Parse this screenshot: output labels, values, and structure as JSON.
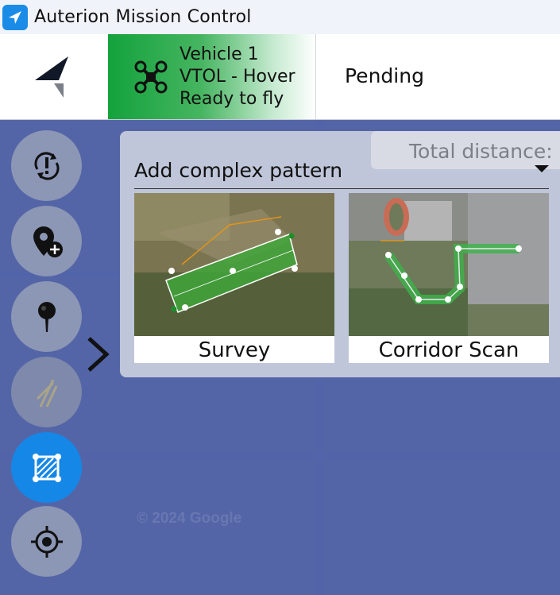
{
  "window": {
    "title": "Auterion Mission Control"
  },
  "header": {
    "vehicle": {
      "name": "Vehicle 1",
      "mode": "VTOL - Hover",
      "state": "Ready to fly"
    },
    "status": "Pending"
  },
  "map": {
    "watermark": "© 2024 Google"
  },
  "toolbar": {
    "items": [
      {
        "name": "sync-mission",
        "icon": "sync-alert-icon",
        "state": "normal"
      },
      {
        "name": "add-waypoint",
        "icon": "location-plus-icon",
        "state": "normal"
      },
      {
        "name": "pin",
        "icon": "pin-icon",
        "state": "normal"
      },
      {
        "name": "rally-point",
        "icon": "rally-icon",
        "state": "disabled"
      },
      {
        "name": "complex-pattern",
        "icon": "pattern-icon",
        "state": "active"
      },
      {
        "name": "center-map",
        "icon": "crosshair-icon",
        "state": "normal"
      }
    ]
  },
  "panel": {
    "title": "Add complex pattern",
    "distance_label": "Total distance:",
    "patterns": [
      {
        "label": "Survey"
      },
      {
        "label": "Corridor Scan"
      }
    ]
  },
  "colors": {
    "accent": "#1587e6",
    "vehicle_ready": "#13a23c",
    "map": "#5365a7"
  }
}
